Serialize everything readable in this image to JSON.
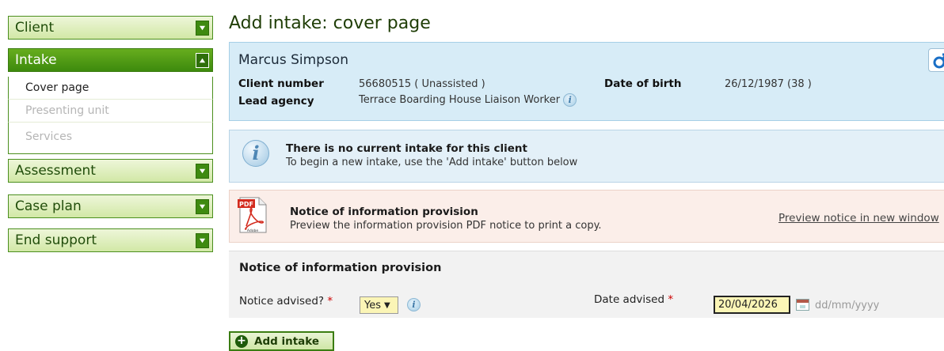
{
  "sidebar": {
    "client": "Client",
    "intake": "Intake",
    "intake_items": [
      "Cover page",
      "Presenting unit",
      "Services"
    ],
    "assessment": "Assessment",
    "case_plan": "Case plan",
    "end_support": "End support"
  },
  "page": {
    "title": "Add intake: cover page"
  },
  "client": {
    "name": "Marcus Simpson",
    "gender_icon": "male-icon",
    "client_number_label": "Client number",
    "client_number": "56680515 ( Unassisted )",
    "dob_label": "Date of birth",
    "dob": "26/12/1987 (38 )",
    "lead_agency_label": "Lead agency",
    "lead_agency": "Terrace Boarding House Liaison Worker"
  },
  "message": {
    "title": "There is no current intake for this client",
    "text": "To begin a new intake, use the 'Add intake' button below"
  },
  "notice": {
    "title": "Notice of information provision",
    "text": "Preview the information provision PDF notice to print a copy.",
    "link": "Preview notice in new window",
    "pdf_label": "PDF",
    "adobe_label": "Adobe"
  },
  "form": {
    "title": "Notice of information provision",
    "notice_label": "Notice advised?",
    "notice_value": "Yes",
    "date_label": "Date advised",
    "required_mark": "*",
    "date_value": "20/04/2026",
    "date_hint": "dd/mm/yyyy"
  },
  "actions": {
    "add_intake": "Add intake"
  },
  "colors": {
    "nav_green": "#3e8a10",
    "client_panel": "#d7ecf7",
    "notice_panel": "#fbeee9",
    "input_highlight": "#fbf5b6"
  }
}
